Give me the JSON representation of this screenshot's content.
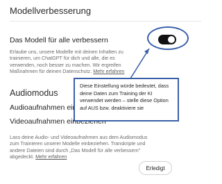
{
  "dialog": {
    "title": "Modellverbesserung"
  },
  "improve_model": {
    "label": "Das Modell für alle verbessern",
    "toggle_on": true,
    "description": "Erlaube uns, unsere Modelle mit deinen Inhalten zu trainieren, um ChatGPT für dich und alle, die es verwenden, noch besser zu machen. Wir ergreifen Maßnahmen für deinen Datenschutz.",
    "learn_more": "Mehr erfahren"
  },
  "audio_section": {
    "title": "Audiomodus",
    "audio_label": "Audioaufnahmen einbeziehen",
    "video_label": "Videoaufnahmen einbeziehen",
    "description": "Lass deine Audio- und Videoaufnahmen aus dem Audiomodus zum Trainieren unserer Modelle einbeziehen. Transkripte und andere Dateien sind durch „Das Modell für alle verbessern\" abgedeckt.",
    "learn_more": "Mehr erfahren"
  },
  "done_button": "Erledigt",
  "annotation": {
    "text": "Diese Einstellung würde bedeutet, dass deine Daten zum Training der KI verwendet werden – stelle diese Option auf AUS bzw. deaktiviere sie"
  },
  "colors": {
    "annotation_blue": "#3a5fa8",
    "toggle_on": "#111111"
  }
}
